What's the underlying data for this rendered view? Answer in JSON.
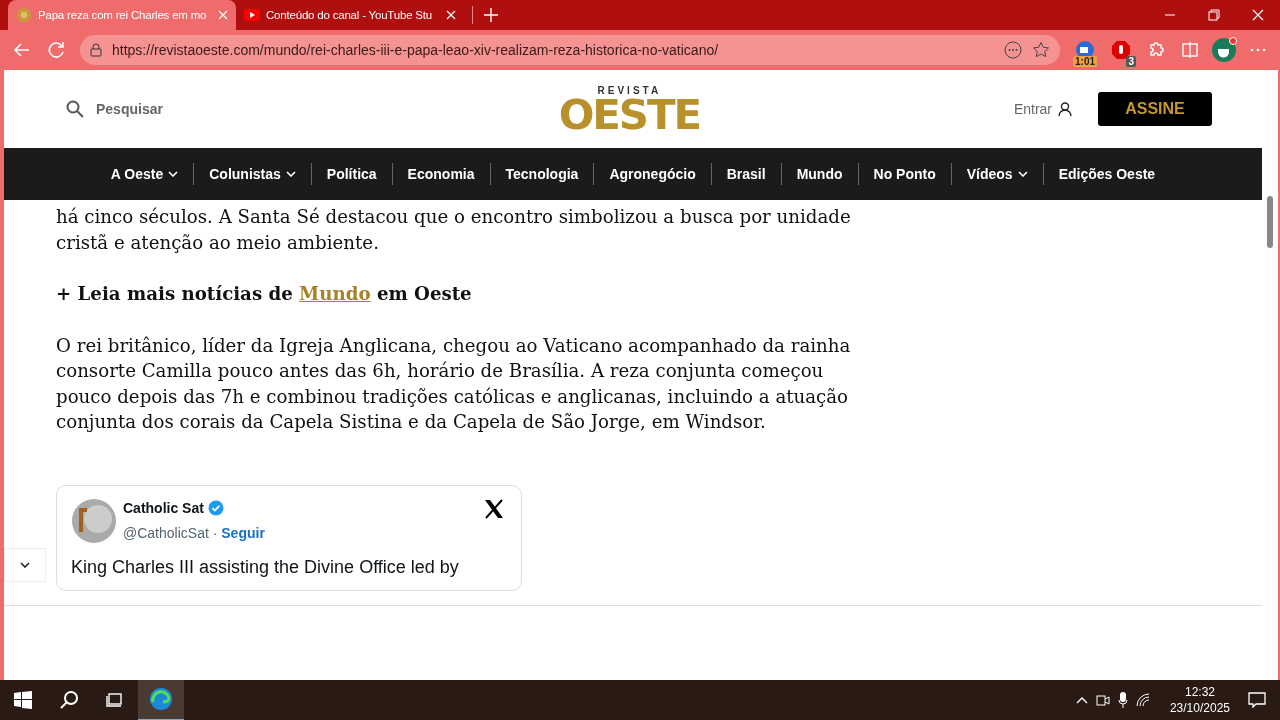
{
  "browser": {
    "tabs": [
      {
        "title": "Papa reza com rei Charles em mo",
        "selected": true
      },
      {
        "title": "Conteúdo do canal - YouTube Stu",
        "selected": false
      }
    ],
    "url": "https://revistaoeste.com/mundo/rei-charles-iii-e-papa-leao-xiv-realizam-reza-historica-no-vaticano/",
    "extension_badges": [
      "1:01",
      "3"
    ]
  },
  "site_header": {
    "search": "Pesquisar",
    "logo_top": "REVISTA",
    "logo_main": "OESTE",
    "login": "Entrar",
    "subscribe": "ASSINE"
  },
  "nav": [
    {
      "label": "A Oeste",
      "dropdown": true
    },
    {
      "label": "Colunistas",
      "dropdown": true
    },
    {
      "label": "Política",
      "dropdown": false
    },
    {
      "label": "Economia",
      "dropdown": false
    },
    {
      "label": "Tecnologia",
      "dropdown": false
    },
    {
      "label": "Agronegócio",
      "dropdown": false
    },
    {
      "label": "Brasil",
      "dropdown": false
    },
    {
      "label": "Mundo",
      "dropdown": false
    },
    {
      "label": "No Ponto",
      "dropdown": false
    },
    {
      "label": "Vídeos",
      "dropdown": true
    },
    {
      "label": "Edições Oeste",
      "dropdown": false
    }
  ],
  "article": {
    "paragraphs": [
      "há cinco séculos. A Santa Sé destacou que o encontro simbolizou a busca por unidade cristã e atenção ao meio ambiente."
    ],
    "related": {
      "prefix": "+ Leia mais notícias de",
      "link": "Mundo",
      "suffix": "em Oeste"
    },
    "paragraphs_after": [
      "O rei britânico, líder da Igreja Anglicana, chegou ao Vaticano acompanhado da rainha consorte Camilla pouco antes das 6h, horário de Brasília. A reza conjunta começou pouco depois das 7h e combinou tradições católicas e anglicanas, incluindo a atuação conjunta dos corais da Capela Sistina e da Capela de São Jorge, em Windsor."
    ]
  },
  "tweet": {
    "name": "Catholic Sat",
    "verified": true,
    "handle": "@CatholicSat",
    "separator": "·",
    "follow": "Seguir",
    "text": "King Charles III assisting the Divine Office led by"
  },
  "taskbar": {
    "time": "12:32",
    "date": "23/10/2025"
  }
}
